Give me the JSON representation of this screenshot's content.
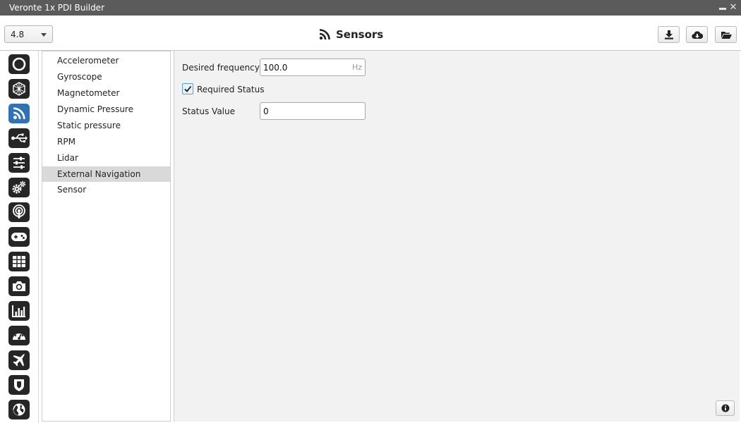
{
  "window": {
    "title": "Veronte 1x PDI Builder"
  },
  "header": {
    "version": "4.8",
    "title": "Sensors"
  },
  "rail": {
    "active_item": "sensors",
    "items": [
      "autopilot-ring",
      "hexagon-network",
      "sensors",
      "usb",
      "sliders",
      "gears",
      "podcast",
      "gamepad",
      "grid",
      "camera",
      "bar-chart",
      "gauge",
      "plane",
      "shield",
      "globe"
    ]
  },
  "sensor_list": {
    "items": [
      "Accelerometer",
      "Gyroscope",
      "Magnetometer",
      "Dynamic Pressure",
      "Static pressure",
      "RPM",
      "Lidar",
      "External Navigation Sensor"
    ],
    "selected": "External Navigation Sensor"
  },
  "form": {
    "desired_frequency": {
      "label": "Desired frequency",
      "value": "100.0",
      "unit": "Hz"
    },
    "required_status": {
      "label": "Required Status",
      "checked": true
    },
    "status_value": {
      "label": "Status Value",
      "value": "0"
    }
  },
  "colors": {
    "titlebar": "#5b5b5b",
    "accent": "#2f73b6",
    "rail_icon": "#262626",
    "selection": "#d9d9d9"
  }
}
